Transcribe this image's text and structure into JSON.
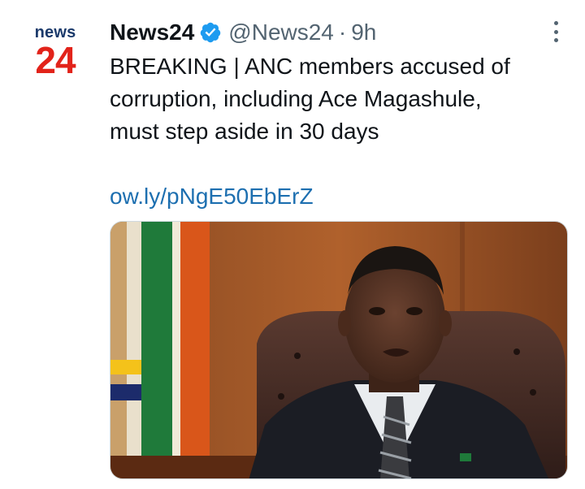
{
  "account": {
    "avatar_text_top": "news",
    "avatar_text_bottom": "24",
    "display_name": "News24",
    "verified": true,
    "handle": "@News24",
    "separator": "·",
    "time": "9h"
  },
  "tweet": {
    "text_lines": [
      "BREAKING | ANC members accused of",
      "corruption, including Ace Magashule,",
      "must step aside in 30 days"
    ],
    "link": "ow.ly/pNgE50EbErZ"
  },
  "icons": {
    "verified": "verified-badge-icon",
    "more": "more-options-icon"
  },
  "colors": {
    "brand_blue": "#1b3a6b",
    "brand_red": "#e2231a",
    "verified": "#1d9bf0",
    "link": "#1d6fb0",
    "muted": "#536471"
  }
}
